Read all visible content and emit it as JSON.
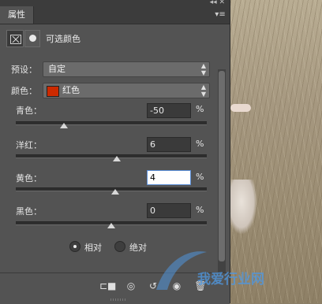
{
  "panel": {
    "tab_title": "属性",
    "header_title": "可选颜色",
    "preset": {
      "label": "预设：",
      "value": "自定"
    },
    "colors": {
      "label": "颜色：",
      "value": "红色",
      "swatch": "#cc2a00"
    },
    "sliders": [
      {
        "label": "青色：",
        "value": "-50",
        "unit": "%",
        "fraction": 0.25
      },
      {
        "label": "洋红：",
        "value": "6",
        "unit": "%",
        "fraction": 0.53
      },
      {
        "label": "黄色：",
        "value": "4",
        "unit": "%",
        "fraction": 0.52
      },
      {
        "label": "黑色：",
        "value": "0",
        "unit": "%",
        "fraction": 0.5
      }
    ],
    "mode": {
      "relative": "相对",
      "absolute": "绝对",
      "selected": "relative"
    }
  },
  "watermark": {
    "text": "我爱行业网"
  },
  "icons": [
    "collapse-arrows-icon",
    "close-icon",
    "panel-menu-icon",
    "adjustment-mask-icon",
    "layer-mask-icon",
    "clip-to-layer-icon",
    "view-previous-state-icon",
    "reset-icon",
    "visibility-eye-icon",
    "trash-icon"
  ]
}
